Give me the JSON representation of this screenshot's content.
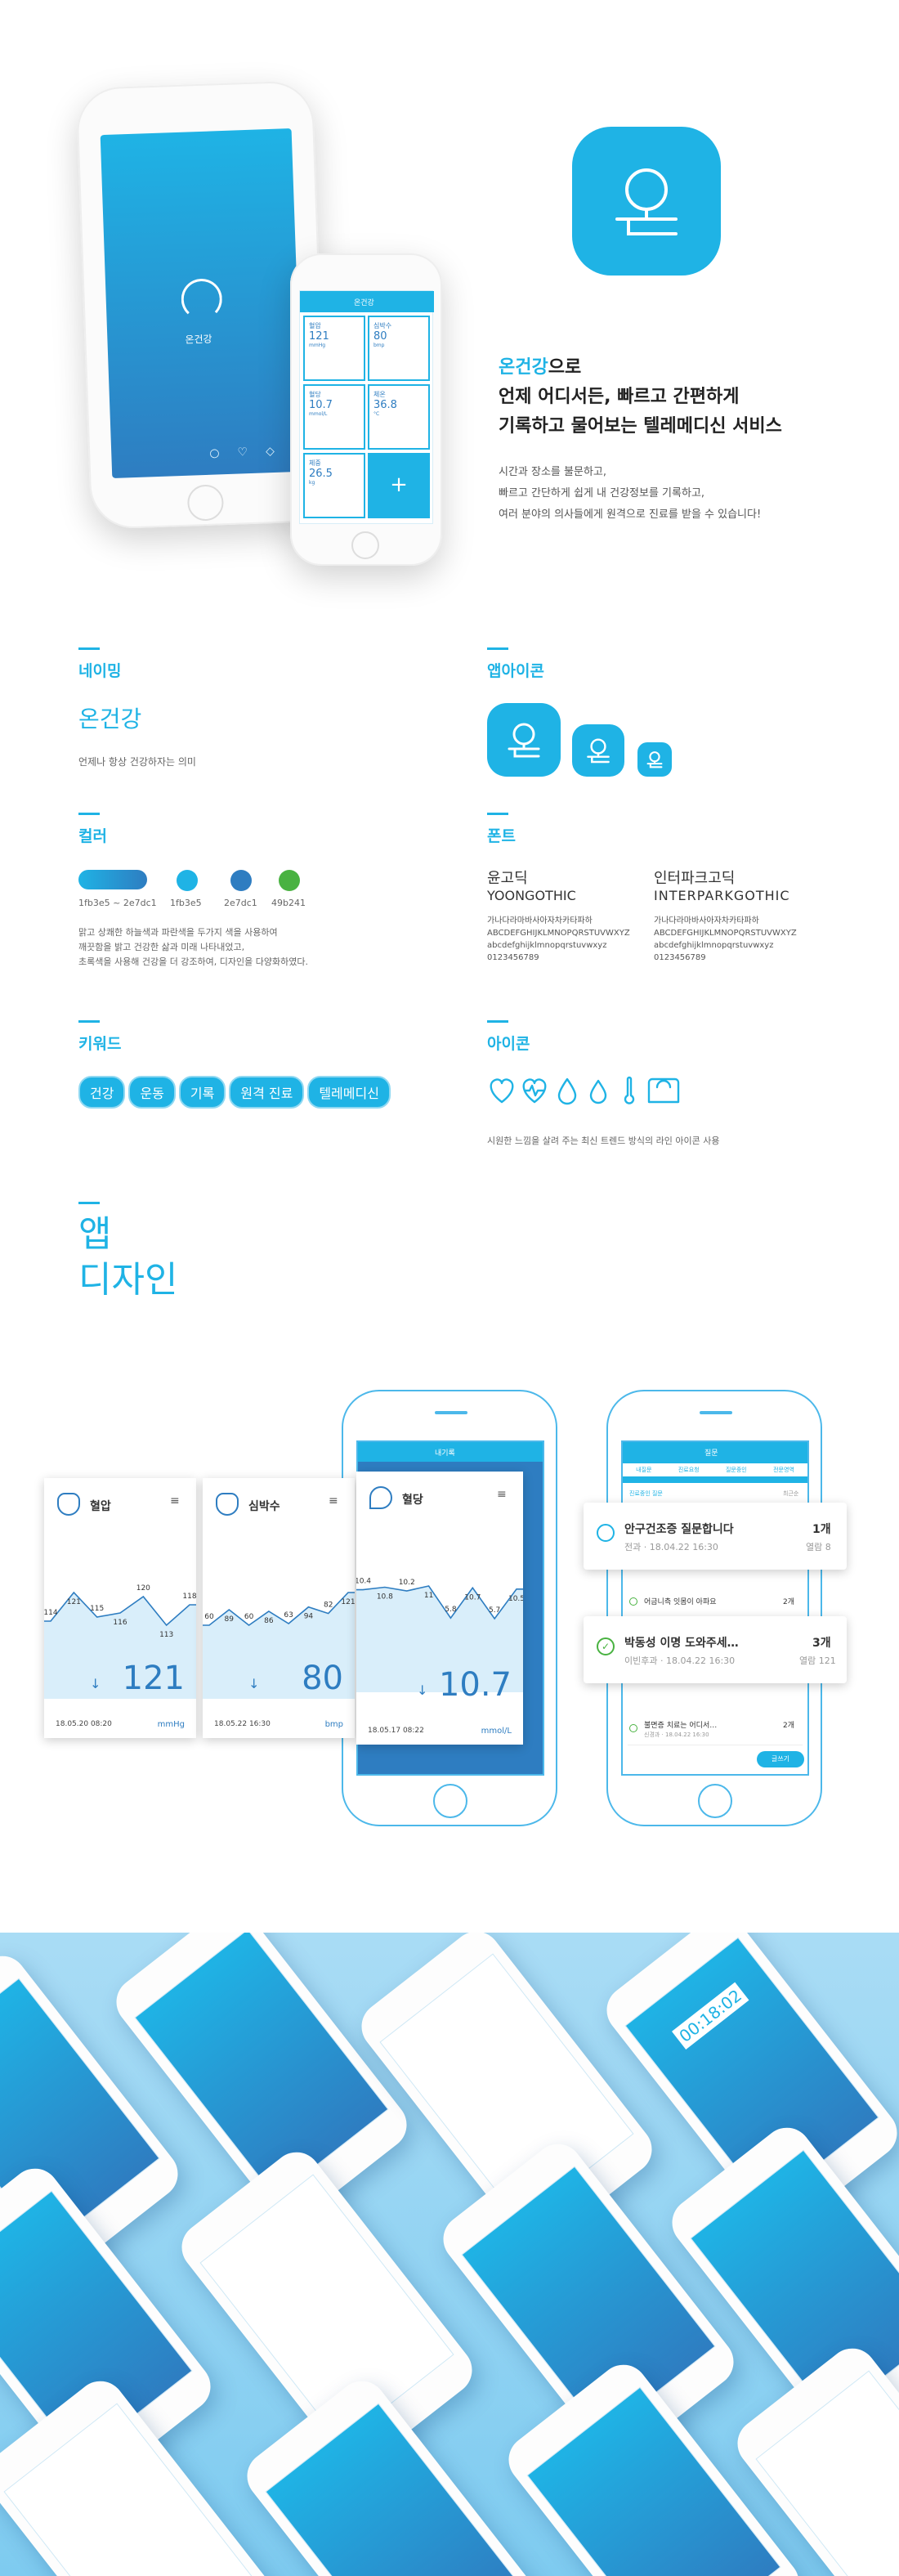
{
  "hero": {
    "phone_brand": "온건강",
    "tagline_brand": "온건강",
    "tagline_rest1": "으로",
    "tagline_line2": "언제 어디서든, 빠르고 간편하게",
    "tagline_line3": "기록하고 물어보는 텔레메디신 서비스",
    "desc1": "시간과 장소를 불문하고,",
    "desc2": "빠르고 간단하게 쉽게 내 건강정보를 기록하고,",
    "desc3": "여러 분야의 의사들에게 원격으로 진료를 받을 수 있습니다!",
    "dash_title": "온건강",
    "tiles": [
      {
        "label": "혈압",
        "value": "121",
        "unit": "mmHg"
      },
      {
        "label": "심박수",
        "value": "80",
        "unit": "bmp"
      },
      {
        "label": "혈당",
        "value": "10.7",
        "unit": "mmol/L"
      },
      {
        "label": "체온",
        "value": "36.8",
        "unit": "°C"
      },
      {
        "label": "체중",
        "value": "26.5",
        "unit": "kg"
      }
    ]
  },
  "naming": {
    "title": "네이밍",
    "name": "온건강",
    "desc": "언제나 항상 건강하자는 의미"
  },
  "appicon": {
    "title": "앱아이콘"
  },
  "color": {
    "title": "컬러",
    "swatches": [
      {
        "label": "1fb3e5 ~ 2e7dc1",
        "hex": "#1fb3e5"
      },
      {
        "label": "1fb3e5",
        "hex": "#1fb3e5"
      },
      {
        "label": "2e7dc1",
        "hex": "#2e7dc1"
      },
      {
        "label": "49b241",
        "hex": "#49b241"
      }
    ],
    "desc1": "맑고 상쾌한 하늘색과 파란색을 두가지 색을 사용하여",
    "desc2": "깨끗함을 밝고 건강한 삶과 미래 나타내었고,",
    "desc3": "초록색을 사용해 건강을 더 강조하여, 디자인을 다양화하였다."
  },
  "font": {
    "title": "폰트",
    "f1_kor": "윤고딕",
    "f1_eng": "YOONGOTHIC",
    "f2_kor": "인터파크고딕",
    "f2_eng": "INTERPARKGOTHIC",
    "s_kor": "가나다라마바사아자차카타파하",
    "s_up": "ABCDEFGHIJKLMNOPQRSTUVWXYZ",
    "s_low": "abcdefghijklmnopqrstuvwxyz",
    "s_num": "0123456789"
  },
  "keyword": {
    "title": "키워드",
    "items": [
      "건강",
      "운동",
      "기록",
      "원격 진료",
      "텔레메디신"
    ]
  },
  "icon": {
    "title": "아이콘",
    "desc": "시원한 느낌을 살려 주는 최신 트렌드 방식의 라인 아이콘 사용"
  },
  "design": {
    "title1": "앱",
    "title2": "디자인"
  },
  "cards": [
    {
      "title": "혈압",
      "value": "121",
      "unit": "mmHg",
      "date": "18.05.20 08:20",
      "points": [
        {
          "v": 114
        },
        {
          "v": 121
        },
        {
          "v": 115
        },
        {
          "v": 116
        },
        {
          "v": 120
        },
        {
          "v": 113
        },
        {
          "v": 118
        }
      ]
    },
    {
      "title": "심박수",
      "value": "80",
      "unit": "bmp",
      "date": "18.05.22 16:30",
      "points": [
        {
          "v": 60
        },
        {
          "v": 89
        },
        {
          "v": 60
        },
        {
          "v": 86
        },
        {
          "v": 63
        },
        {
          "v": 94
        },
        {
          "v": 82
        },
        {
          "v": 121
        }
      ]
    },
    {
      "title": "혈당",
      "value": "10.7",
      "unit": "mmol/L",
      "date": "18.05.17 08:22",
      "points": [
        {
          "v": 10.4
        },
        {
          "v": 10.8
        },
        {
          "v": 10.2
        },
        {
          "v": 11
        },
        {
          "v": 5.8
        },
        {
          "v": 10.7
        },
        {
          "v": 5.7
        },
        {
          "v": 10.5
        }
      ]
    }
  ],
  "right_phone": {
    "header": "질문",
    "tabs": [
      "내질문",
      "진료요청",
      "질문중인",
      "전문영역"
    ],
    "filter": "진료중인 질문",
    "more": "최근순",
    "q1": {
      "title": "안구건조증 질문합니다",
      "meta": "전과 · 18.04.22 16:30",
      "count": "1개",
      "views": "열람 8"
    },
    "q2": {
      "title": "어금니측 잇몸이 아파요",
      "count": "2개"
    },
    "q3": {
      "title": "박동성 이명 도와주세…",
      "meta": "이빈후과 · 18.04.22 16:30",
      "count": "3개",
      "views": "열람 121"
    },
    "q4": {
      "title": "불면증 치료는 어디서…",
      "meta": "신경과 · 18.04.22 16:30",
      "count": "2개"
    },
    "write": "글쓰기"
  },
  "middle_phone": {
    "header": "내기록"
  },
  "pattern": {
    "timer": "00:18:02"
  }
}
